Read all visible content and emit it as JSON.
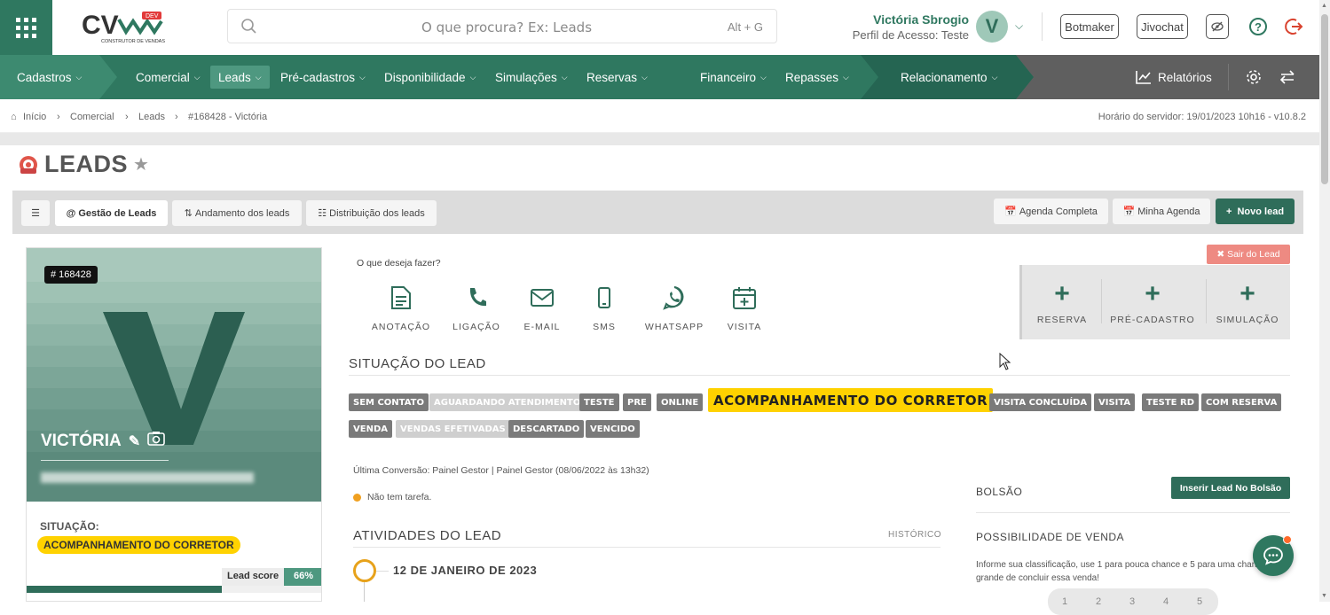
{
  "logo": {
    "text": "CV",
    "badge": "DEV",
    "subtitle": "CONSTRUTOR DE VENDAS"
  },
  "search": {
    "placeholder": "O que procura? Ex: Leads",
    "shortcut": "Alt + G"
  },
  "user": {
    "name": "Victória Sbrogio",
    "profile": "Perfil de Acesso: Teste",
    "initial": "V"
  },
  "top_buttons": {
    "botmaker": "Botmaker",
    "jivochat": "Jivochat"
  },
  "nav": {
    "items": [
      {
        "label": "Cadastros"
      },
      {
        "label": "Comercial"
      },
      {
        "label": "Leads"
      },
      {
        "label": "Pré-cadastros"
      },
      {
        "label": "Disponibilidade"
      },
      {
        "label": "Simulações"
      },
      {
        "label": "Reservas"
      },
      {
        "label": "Financeiro"
      },
      {
        "label": "Repasses"
      },
      {
        "label": "Relacionamento"
      }
    ],
    "reports": "Relatórios"
  },
  "breadcrumb": {
    "items": [
      "Início",
      "Comercial",
      "Leads",
      "#168428 - Victória"
    ],
    "server": "Horário do servidor: 19/01/2023 10h16 - v10.8.2"
  },
  "page": {
    "title": "LEADS"
  },
  "toolbar": {
    "gestao": "Gestão de Leads",
    "andamento": "Andamento dos leads",
    "distribuicao": "Distribuição dos leads",
    "agenda_completa": "Agenda Completa",
    "minha_agenda": "Minha Agenda",
    "novo_lead": "Novo lead"
  },
  "lead": {
    "id": "# 168428",
    "name": "VICTÓRIA",
    "situation_label": "SITUAÇÃO:",
    "situation": "ACOMPANHAMENTO DO CORRETOR",
    "score_label": "Lead score",
    "score": "66%",
    "score_fraction": 0.66
  },
  "actions": {
    "question": "O que deseja fazer?",
    "items": [
      "ANOTAÇÃO",
      "LIGAÇÃO",
      "E-MAIL",
      "SMS",
      "WHATSAPP",
      "VISITA"
    ],
    "exit": "Sair do Lead",
    "add": [
      "RESERVA",
      "PRÉ-CADASTRO",
      "SIMULAÇÃO"
    ]
  },
  "status": {
    "title": "SITUAÇÃO DO LEAD",
    "tags": [
      "SEM CONTATO",
      "AGUARDANDO ATENDIMENTO",
      "TESTE",
      "PRE",
      "ONLINE",
      "ACOMPANHAMENTO DO CORRETOR",
      "VISITA CONCLUÍDA",
      "VISITA",
      "TESTE RD",
      "COM RESERVA",
      "VENDA",
      "VENDAS EFETIVADAS",
      "DESCARTADO",
      "VENCIDO"
    ]
  },
  "conversion": "Última Conversão: Painel Gestor | Painel Gestor (08/06/2022 às 13h32)",
  "task": "Não tem tarefa.",
  "activities": {
    "title": "ATIVIDADES DO LEAD",
    "history": "HISTÓRICO",
    "date": "12 DE JANEIRO DE 2023"
  },
  "side": {
    "bolsao": "BOLSÃO",
    "inserir": "Inserir Lead No Bolsão",
    "possibilidade": "POSSIBILIDADE DE VENDA",
    "info": "Informe sua classificação, use 1 para pouca chance e 5 para uma chance grande de concluir essa venda!",
    "ratings": [
      "1",
      "2",
      "3",
      "4",
      "5"
    ]
  },
  "colors": {
    "primary": "#2f7860",
    "accent": "#ffd200",
    "danger": "#ee8a82"
  }
}
